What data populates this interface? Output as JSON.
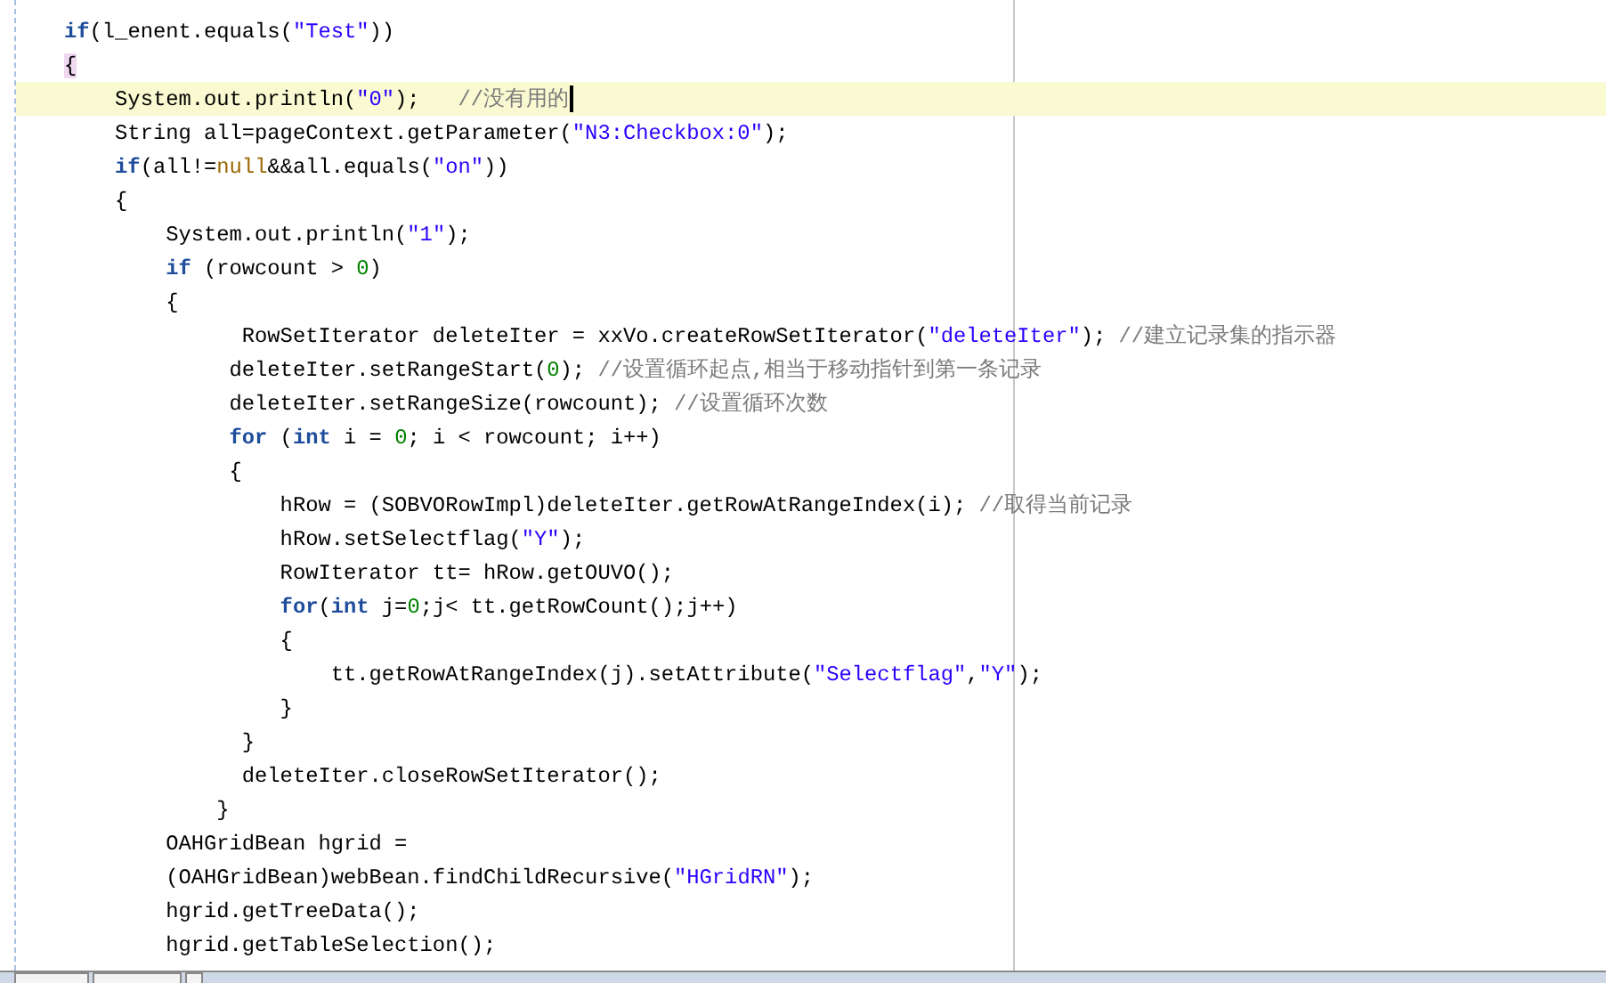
{
  "editor": {
    "lines": [
      {
        "current": false,
        "cursor": false,
        "tokens": [
          {
            "kind": "keyword",
            "text": "if"
          },
          {
            "kind": "plain",
            "text": "(l_enent.equals("
          },
          {
            "kind": "string",
            "text": "\"Test\""
          },
          {
            "kind": "plain",
            "text": "))"
          }
        ]
      },
      {
        "current": false,
        "cursor": false,
        "tokens": [
          {
            "kind": "brace-match",
            "text": "{"
          }
        ]
      },
      {
        "current": true,
        "cursor": true,
        "tokens": [
          {
            "kind": "plain",
            "text": "    System.out.println("
          },
          {
            "kind": "string",
            "text": "\"0\""
          },
          {
            "kind": "plain",
            "text": ");   "
          },
          {
            "kind": "comment",
            "text": "//没有用的"
          }
        ]
      },
      {
        "current": false,
        "cursor": false,
        "tokens": [
          {
            "kind": "plain",
            "text": "    String all=pageContext.getParameter("
          },
          {
            "kind": "string",
            "text": "\"N3:Checkbox:0\""
          },
          {
            "kind": "plain",
            "text": ");"
          }
        ]
      },
      {
        "current": false,
        "cursor": false,
        "tokens": [
          {
            "kind": "keyword",
            "text": "    if"
          },
          {
            "kind": "plain",
            "text": "(all!="
          },
          {
            "kind": "null",
            "text": "null"
          },
          {
            "kind": "plain",
            "text": "&&all.equals("
          },
          {
            "kind": "string",
            "text": "\"on\""
          },
          {
            "kind": "plain",
            "text": "))"
          }
        ]
      },
      {
        "current": false,
        "cursor": false,
        "tokens": [
          {
            "kind": "plain",
            "text": "    {"
          }
        ]
      },
      {
        "current": false,
        "cursor": false,
        "tokens": [
          {
            "kind": "plain",
            "text": "        System.out.println("
          },
          {
            "kind": "string",
            "text": "\"1\""
          },
          {
            "kind": "plain",
            "text": ");"
          }
        ]
      },
      {
        "current": false,
        "cursor": false,
        "tokens": [
          {
            "kind": "keyword",
            "text": "        if"
          },
          {
            "kind": "plain",
            "text": " (rowcount > "
          },
          {
            "kind": "number",
            "text": "0"
          },
          {
            "kind": "plain",
            "text": ")"
          }
        ]
      },
      {
        "current": false,
        "cursor": false,
        "tokens": [
          {
            "kind": "plain",
            "text": "        {"
          }
        ]
      },
      {
        "current": false,
        "cursor": false,
        "tokens": [
          {
            "kind": "plain",
            "text": "              RowSetIterator deleteIter = xxVo.createRowSetIterator("
          },
          {
            "kind": "string",
            "text": "\"deleteIter\""
          },
          {
            "kind": "plain",
            "text": "); "
          },
          {
            "kind": "comment",
            "text": "//建立记录集的指示器"
          }
        ]
      },
      {
        "current": false,
        "cursor": false,
        "tokens": [
          {
            "kind": "plain",
            "text": "             deleteIter.setRangeStart("
          },
          {
            "kind": "number",
            "text": "0"
          },
          {
            "kind": "plain",
            "text": "); "
          },
          {
            "kind": "comment",
            "text": "//设置循环起点,相当于移动指针到第一条记录"
          }
        ]
      },
      {
        "current": false,
        "cursor": false,
        "tokens": [
          {
            "kind": "plain",
            "text": "             deleteIter.setRangeSize(rowcount); "
          },
          {
            "kind": "comment",
            "text": "//设置循环次数"
          }
        ]
      },
      {
        "current": false,
        "cursor": false,
        "tokens": [
          {
            "kind": "keyword",
            "text": "             for"
          },
          {
            "kind": "plain",
            "text": " ("
          },
          {
            "kind": "keyword",
            "text": "int"
          },
          {
            "kind": "plain",
            "text": " i = "
          },
          {
            "kind": "number",
            "text": "0"
          },
          {
            "kind": "plain",
            "text": "; i < rowcount; i++)"
          }
        ]
      },
      {
        "current": false,
        "cursor": false,
        "tokens": [
          {
            "kind": "plain",
            "text": "             {"
          }
        ]
      },
      {
        "current": false,
        "cursor": false,
        "tokens": [
          {
            "kind": "plain",
            "text": "                 hRow = (SOBVORowImpl)deleteIter.getRowAtRangeIndex(i); "
          },
          {
            "kind": "comment",
            "text": "//取得当前记录"
          }
        ]
      },
      {
        "current": false,
        "cursor": false,
        "tokens": [
          {
            "kind": "plain",
            "text": "                 hRow.setSelectflag("
          },
          {
            "kind": "string",
            "text": "\"Y\""
          },
          {
            "kind": "plain",
            "text": ");"
          }
        ]
      },
      {
        "current": false,
        "cursor": false,
        "tokens": [
          {
            "kind": "plain",
            "text": "                 RowIterator tt= hRow.getOUVO();"
          }
        ]
      },
      {
        "current": false,
        "cursor": false,
        "tokens": [
          {
            "kind": "keyword",
            "text": "                 for"
          },
          {
            "kind": "plain",
            "text": "("
          },
          {
            "kind": "keyword",
            "text": "int"
          },
          {
            "kind": "plain",
            "text": " j="
          },
          {
            "kind": "number",
            "text": "0"
          },
          {
            "kind": "plain",
            "text": ";j< tt.getRowCount();j++)"
          }
        ]
      },
      {
        "current": false,
        "cursor": false,
        "tokens": [
          {
            "kind": "plain",
            "text": "                 {"
          }
        ]
      },
      {
        "current": false,
        "cursor": false,
        "tokens": [
          {
            "kind": "plain",
            "text": "                     tt.getRowAtRangeIndex(j).setAttribute("
          },
          {
            "kind": "string",
            "text": "\"Selectflag\""
          },
          {
            "kind": "plain",
            "text": ","
          },
          {
            "kind": "string",
            "text": "\"Y\""
          },
          {
            "kind": "plain",
            "text": ");"
          }
        ]
      },
      {
        "current": false,
        "cursor": false,
        "tokens": [
          {
            "kind": "plain",
            "text": "                 }"
          }
        ]
      },
      {
        "current": false,
        "cursor": false,
        "tokens": [
          {
            "kind": "plain",
            "text": "              }"
          }
        ]
      },
      {
        "current": false,
        "cursor": false,
        "tokens": [
          {
            "kind": "plain",
            "text": "              deleteIter.closeRowSetIterator();"
          }
        ]
      },
      {
        "current": false,
        "cursor": false,
        "tokens": [
          {
            "kind": "plain",
            "text": "            }"
          }
        ]
      },
      {
        "current": false,
        "cursor": false,
        "tokens": [
          {
            "kind": "plain",
            "text": "        OAHGridBean hgrid ="
          }
        ]
      },
      {
        "current": false,
        "cursor": false,
        "tokens": [
          {
            "kind": "plain",
            "text": "        (OAHGridBean)webBean.findChildRecursive("
          },
          {
            "kind": "string",
            "text": "\"HGridRN\""
          },
          {
            "kind": "plain",
            "text": ");"
          }
        ]
      },
      {
        "current": false,
        "cursor": false,
        "tokens": [
          {
            "kind": "plain",
            "text": "        hgrid.getTreeData();"
          }
        ]
      },
      {
        "current": false,
        "cursor": false,
        "tokens": [
          {
            "kind": "plain",
            "text": "        hgrid.getTableSelection();"
          }
        ]
      }
    ]
  }
}
